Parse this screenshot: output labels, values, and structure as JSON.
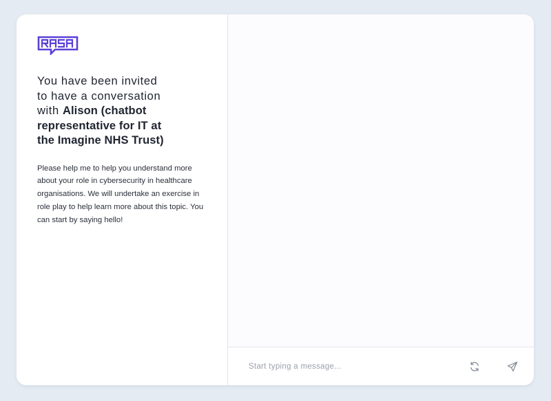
{
  "brand": {
    "logo_text": "RASA",
    "accent_color": "#5a3fd6"
  },
  "intro": {
    "heading_prefix": "You have been invited to have a conversation with",
    "heading_name": "Alison (chatbot representative for IT at the Imagine NHS Trust)",
    "description": "Please help me to help you understand more about your role in cybersecurity in healthcare organisations. We will undertake an exercise in role play to help learn more about this topic. You can start by saying hello!"
  },
  "composer": {
    "input_value": "",
    "placeholder": "Start typing a message...",
    "restart_icon": "refresh-icon",
    "send_icon": "send-icon"
  }
}
